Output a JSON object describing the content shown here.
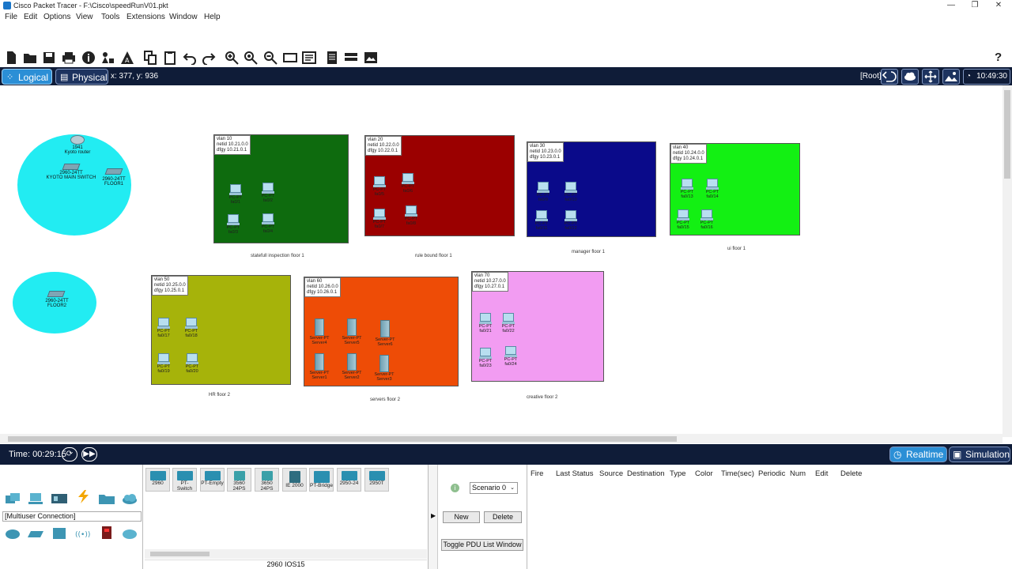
{
  "window": {
    "title": "Cisco Packet Tracer - F:\\Cisco\\speedRunV01.pkt",
    "minimize": "—",
    "restore": "❐",
    "close": "✕"
  },
  "menu": [
    "File",
    "Edit",
    "Options",
    "View",
    "Tools",
    "Extensions",
    "Window",
    "Help"
  ],
  "help_icon": "?",
  "tabs": {
    "logical": "Logical",
    "physical": "Physical"
  },
  "coords": "x: 377, y: 936",
  "root": "[Root]",
  "clock": "10:49:30",
  "clouds": [
    {
      "lines": [
        "1941",
        "Kyoto router",
        "2960-24TT",
        "KYOTO MAIN SWITCH",
        "2960-24TT",
        "FLOOR1"
      ]
    },
    {
      "lines": [
        "2960-24TT",
        "FLOOR2"
      ]
    }
  ],
  "zones": [
    {
      "label": "vlan 10\nnetid 10.21.0.0\ndfgy 10.21.0.1",
      "caption": "statefull inspection floor 1",
      "color": "#0e6b0e",
      "devices": [
        "PC-PT\nfa0/1",
        "PC-PT\nfa0/2",
        "PC-PT\nfa0/3",
        "PC-PT\nfa0/4"
      ]
    },
    {
      "label": "vlan 20\nnetid 10.22.0.0\ndfgy 10.22.0.1",
      "caption": "rule bound floor 1",
      "color": "#9b0000",
      "devices": [
        "PC-PT\nfa0/5",
        "PC-PT\nfa0/6",
        "PC-PT\nfa0/7",
        "PC-PT\nfa0/8"
      ]
    },
    {
      "label": "vlan 30\nnetid 10.23.0.0\ndfgy 10.23.0.1",
      "caption": "manager floor 1",
      "color": "#0a0a8a",
      "devices": [
        "PC-PT\nfa0/9",
        "PC-PT\nfa0/10",
        "PC-PT\nfa0/11",
        "PC-PT\nfa0/12"
      ]
    },
    {
      "label": "vlan 40\nnetid 10.24.0.0\ndfgy 10.24.0.1",
      "caption": "ui floor 1",
      "color": "#13f013",
      "devices": [
        "PC-PT\nfa0/13",
        "PC-PT\nfa0/14",
        "PC-PT\nfa0/15",
        "PC-PT\nfa0/16"
      ]
    },
    {
      "label": "vlan 50\nnetid 10.25.0.0\ndfgy 10.25.0.1",
      "caption": "HR floor 2",
      "color": "#a6b30a",
      "devices": [
        "PC-PT\nfa0/17",
        "PC-PT\nfa0/18",
        "PC-PT\nfa0/19",
        "PC-PT\nfa0/20"
      ]
    },
    {
      "label": "vlan 60\nnetid 10.26.0.0\ndfgy 10.26.0.1",
      "caption": "servers floor 2",
      "color": "#ee4c06",
      "devices": [
        "Server-PT\nServer4",
        "Server-PT\nServer5",
        "Server-PT\nServer6",
        "Server-PT\nServer1",
        "Server-PT\nServer2",
        "Server-PT\nServer3"
      ]
    },
    {
      "label": "vlan 70\nnetid 10.27.0.0\ndfgy 10.27.0.1",
      "caption": "creative floor 2",
      "color": "#f29cf2",
      "devices": [
        "PC-PT\nfa0/21",
        "PC-PT\nfa0/22",
        "PC-PT\nfa0/23",
        "PC-PT\nfa0/24"
      ]
    }
  ],
  "status": {
    "time": "Time: 00:29:15",
    "realtime": "Realtime",
    "simulation": "Simulation"
  },
  "bottom": {
    "multiuser": "[Multiuser Connection]",
    "device_tiles": [
      "2960",
      "PT-Switch",
      "PT-Empty",
      "3560\n24PS",
      "3650\n24PS",
      "IE 2000",
      "PT-Bridge",
      "2950-24",
      "2950T"
    ],
    "device_name": "2960 IOS15",
    "scenario": "Scenario 0",
    "new_label": "New",
    "delete_label": "Delete",
    "toggle_label": "Toggle PDU List Window",
    "pdu_columns": [
      "Fire",
      "Last Status",
      "Source",
      "Destination",
      "Type",
      "Color",
      "Time(sec)",
      "Periodic",
      "Num",
      "Edit",
      "Delete"
    ]
  }
}
